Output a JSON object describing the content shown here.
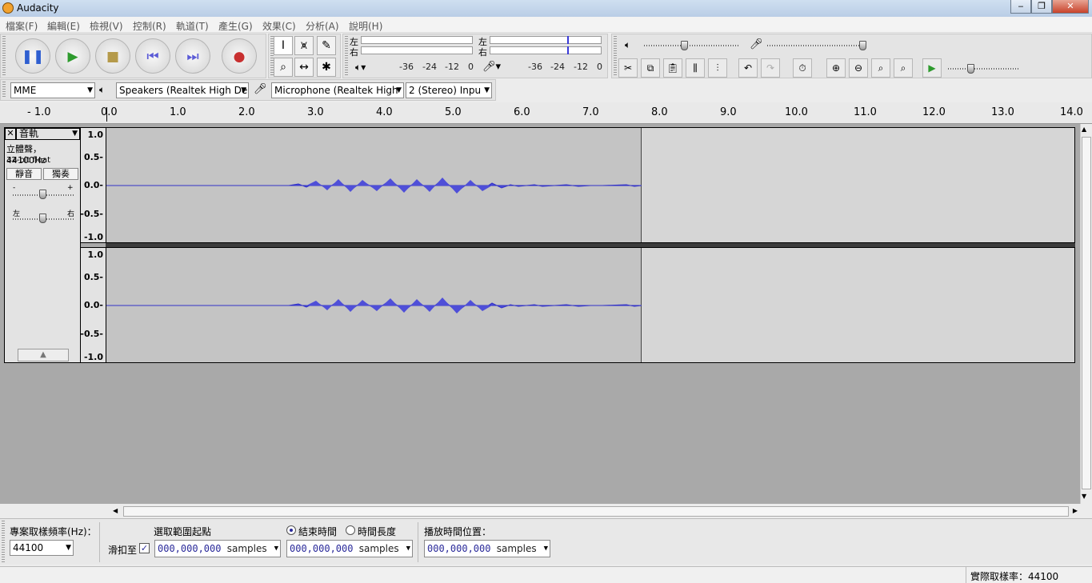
{
  "window": {
    "title": "Audacity",
    "buttons": [
      "‒",
      "❐",
      "✕"
    ]
  },
  "menu": [
    "檔案(F)",
    "編輯(E)",
    "檢視(V)",
    "控制(R)",
    "軌道(T)",
    "產生(G)",
    "效果(C)",
    "分析(A)",
    "說明(H)"
  ],
  "meter": {
    "left": "左",
    "right": "右",
    "scale": [
      "-36",
      "-24",
      "-12",
      "0"
    ]
  },
  "device": {
    "host": "MME",
    "output": "Speakers (Realtek High De",
    "input": "Microphone (Realtek High",
    "channels": "2 (Stereo) Inpu"
  },
  "ruler": [
    "- 1.0",
    "0.0",
    "1.0",
    "2.0",
    "3.0",
    "4.0",
    "5.0",
    "6.0",
    "7.0",
    "8.0",
    "9.0",
    "10.0",
    "11.0",
    "12.0",
    "13.0",
    "14.0"
  ],
  "track": {
    "name": "音軌",
    "info": "立體聲，44100Hz",
    "format": "32-bit float",
    "mute": "靜音",
    "solo": "獨奏",
    "gain_minus": "-",
    "gain_plus": "+",
    "pan_left": "左",
    "pan_right": "右",
    "close": "✕"
  },
  "vscale": [
    "1.0",
    "0.5-",
    "0.0-",
    "-0.5-",
    "-1.0"
  ],
  "selection": {
    "rate_label": "專案取樣頻率(Hz)：",
    "rate_value": "44100",
    "snap_label": "滑扣至",
    "start_label": "選取範圍起點",
    "end_label": "結束時間",
    "length_label": "時間長度",
    "audio_pos_label": "播放時間位置：",
    "time_value": "000,000,000",
    "unit": "samples"
  },
  "status": {
    "actual_rate": "實際取樣率：44100"
  }
}
